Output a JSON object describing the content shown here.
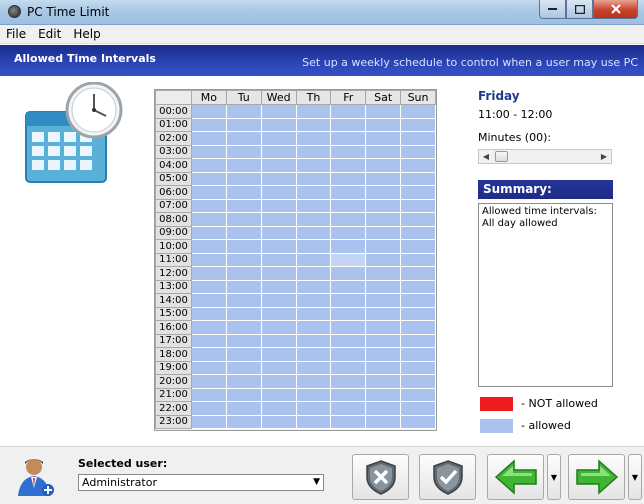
{
  "window": {
    "title": "PC Time Limit"
  },
  "menu": [
    "File",
    "Edit",
    "Help"
  ],
  "header": {
    "title": "Allowed Time Intervals",
    "subtitle": "Set up a weekly schedule to control when a user may use PC"
  },
  "grid": {
    "days": [
      "Mo",
      "Tu",
      "Wed",
      "Th",
      "Fr",
      "Sat",
      "Sun"
    ],
    "hours": [
      "00:00",
      "01:00",
      "02:00",
      "03:00",
      "04:00",
      "05:00",
      "06:00",
      "07:00",
      "08:00",
      "09:00",
      "10:00",
      "11:00",
      "12:00",
      "13:00",
      "14:00",
      "15:00",
      "16:00",
      "17:00",
      "18:00",
      "19:00",
      "20:00",
      "21:00",
      "22:00",
      "23:00"
    ],
    "selected": {
      "day": "Fr",
      "hour": "11:00"
    }
  },
  "details": {
    "day": "Friday",
    "time_range": "11:00 - 12:00",
    "minutes_label": "Minutes (00):",
    "minutes_value": 0
  },
  "summary": {
    "heading": "Summary:",
    "line1": "Allowed time intervals:",
    "line2": "All day allowed"
  },
  "legend": {
    "not_allowed": "- NOT allowed",
    "allowed": "- allowed",
    "not_allowed_color": "#ee1c1c",
    "allowed_color": "#a9c2ee"
  },
  "bottom": {
    "selected_user_label": "Selected user:",
    "selected_user": "Administrator"
  },
  "icons": {
    "app": "clock-icon",
    "deny": "shield-x-icon",
    "allow": "shield-check-icon",
    "back": "arrow-left-icon",
    "forward": "arrow-right-icon"
  }
}
